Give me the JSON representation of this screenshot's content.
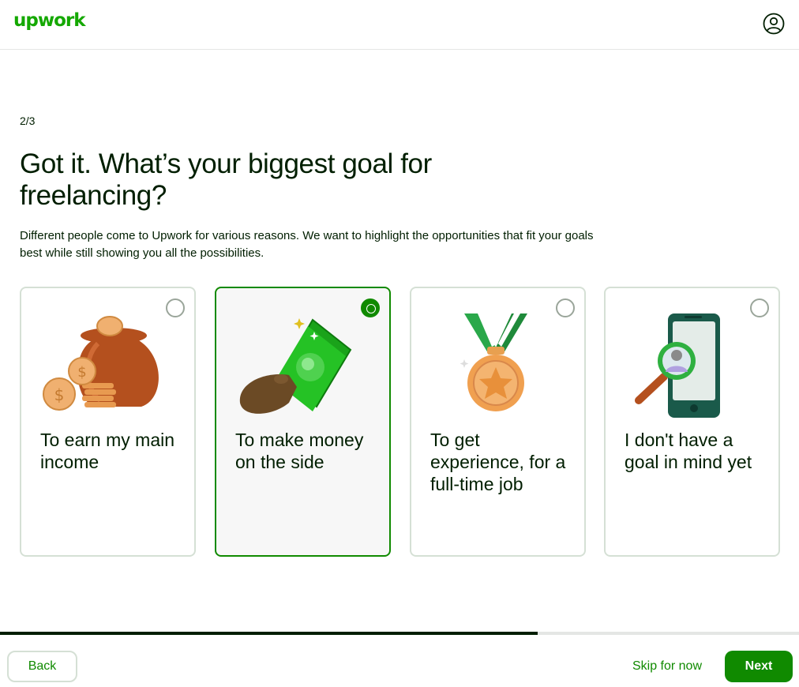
{
  "header": {
    "logo_text": "upwork",
    "account_icon": "user-circle-icon"
  },
  "step_indicator": "2/3",
  "title": "Got it. What’s your biggest goal for freelancing?",
  "subtitle": "Different people come to Upwork for various reasons. We want to highlight the opportunities that fit your goals best while still showing you all the possibilities.",
  "options": [
    {
      "label": "To earn my main income",
      "icon": "coin-bag-icon",
      "selected": false
    },
    {
      "label": "To make money on the side",
      "icon": "cash-in-hand-icon",
      "selected": true
    },
    {
      "label": "To get experience, for a full-time job",
      "icon": "medal-icon",
      "selected": false
    },
    {
      "label": "I don't have a goal in mind yet",
      "icon": "phone-magnifier-icon",
      "selected": false
    }
  ],
  "progress": {
    "value": 0.673
  },
  "footer": {
    "back_label": "Back",
    "skip_label": "Skip for now",
    "next_label": "Next"
  },
  "colors": {
    "brand": "#14a800",
    "primary": "#108a00",
    "text": "#001e00",
    "border": "#d5e0d5"
  }
}
